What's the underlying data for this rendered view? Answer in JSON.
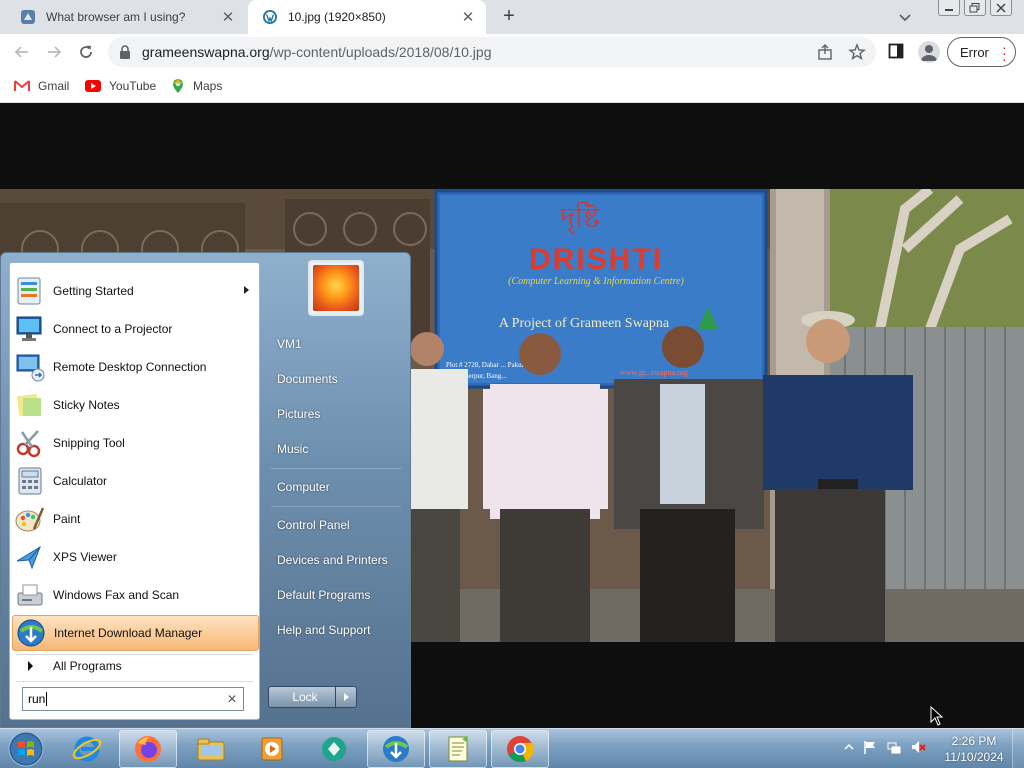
{
  "browser": {
    "tabs": [
      {
        "title": "What browser am I using?",
        "active": false
      },
      {
        "title": "10.jpg (1920×850)",
        "active": true
      }
    ],
    "new_tab_label": "+",
    "url_domain": "grameenswapna.org",
    "url_path": "/wp-content/uploads/2018/08/10.jpg",
    "error_label": "Error",
    "bookmarks": [
      {
        "label": "Gmail",
        "icon": "gmail-icon"
      },
      {
        "label": "YouTube",
        "icon": "youtube-icon"
      },
      {
        "label": "Maps",
        "icon": "maps-icon"
      }
    ]
  },
  "photo": {
    "sign_bengali": "দৃষ্টি",
    "sign_title": "DRISHTI",
    "sign_subtitle": "(Computer Learning & Information Centre)",
    "sign_project": "A Project of Grameen Swapna",
    "sign_addr1": "Plot # 2728, Dabar ... Pakuria",
    "sign_addr2": "Dist. Sherpur, Bang...",
    "sign_web": "www.gr...swapna.org"
  },
  "start_menu": {
    "programs": [
      {
        "label": "Getting Started",
        "icon": "getting-started-icon",
        "has_submenu": true
      },
      {
        "label": "Connect to a Projector",
        "icon": "projector-icon"
      },
      {
        "label": "Remote Desktop Connection",
        "icon": "remote-desktop-icon"
      },
      {
        "label": "Sticky Notes",
        "icon": "sticky-notes-icon"
      },
      {
        "label": "Snipping Tool",
        "icon": "snipping-tool-icon"
      },
      {
        "label": "Calculator",
        "icon": "calculator-icon"
      },
      {
        "label": "Paint",
        "icon": "paint-icon"
      },
      {
        "label": "XPS Viewer",
        "icon": "xps-viewer-icon"
      },
      {
        "label": "Windows Fax and Scan",
        "icon": "fax-scan-icon"
      },
      {
        "label": "Internet Download Manager",
        "icon": "idm-icon",
        "highlighted": true
      }
    ],
    "all_programs": "All Programs",
    "search_value": "run",
    "right_items": [
      "VM1",
      "Documents",
      "Pictures",
      "Music",
      "Computer",
      "Control Panel",
      "Devices and Printers",
      "Default Programs",
      "Help and Support"
    ],
    "lock_label": "Lock"
  },
  "taskbar": {
    "pinned": [
      "internet-explorer-icon",
      "firefox-icon",
      "explorer-folder-icon",
      "media-player-icon",
      "app-icon",
      "idm-icon",
      "notepad-icon",
      "chrome-icon"
    ],
    "time": "2:26 PM",
    "date": "11/10/2024"
  }
}
